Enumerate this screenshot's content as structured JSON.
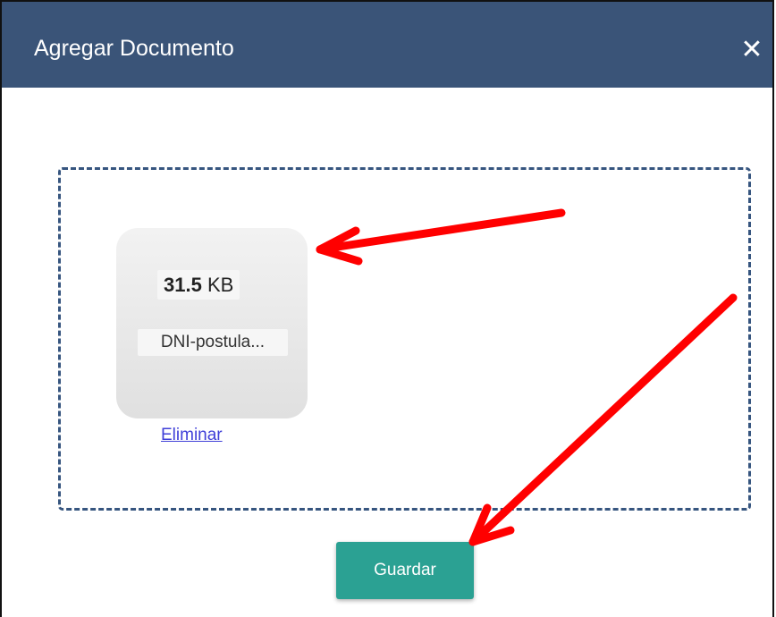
{
  "modal": {
    "title": "Agregar Documento",
    "close_label": "✕"
  },
  "file": {
    "size_value": "31.5",
    "size_unit": "KB",
    "name": "DNI-postula...",
    "remove_label": "Eliminar"
  },
  "footer": {
    "save_label": "Guardar"
  },
  "colors": {
    "header": "#3a5478",
    "accent": "#2ba193",
    "annotation": "#ff0000"
  }
}
